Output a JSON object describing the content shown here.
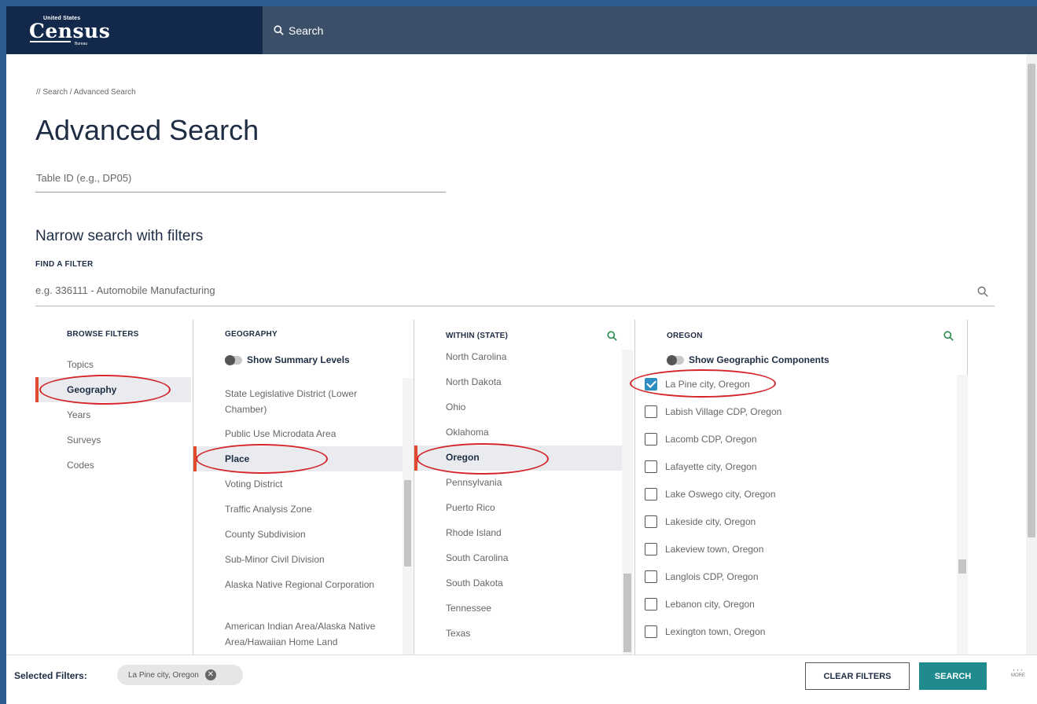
{
  "header": {
    "logo_top": "United States",
    "logo_main": "Census",
    "logo_bottom": "Bureau",
    "search_label": "Search"
  },
  "breadcrumb": "// Search / Advanced Search",
  "title": "Advanced Search",
  "table_id_placeholder": "Table ID (e.g., DP05)",
  "narrow_heading": "Narrow search with filters",
  "find_filter": {
    "label": "FIND A FILTER",
    "placeholder": "e.g. 336111 - Automobile Manufacturing"
  },
  "browse": {
    "heading": "BROWSE FILTERS",
    "items": [
      "Topics",
      "Geography",
      "Years",
      "Surveys",
      "Codes"
    ],
    "selected": "Geography"
  },
  "geography": {
    "heading": "GEOGRAPHY",
    "toggle_label": "Show Summary Levels",
    "items": [
      "State Legislative District (Lower Chamber)",
      "Public Use Microdata Area",
      "Place",
      "Voting District",
      "Traffic Analysis Zone",
      "County Subdivision",
      "Sub-Minor Civil Division",
      "Alaska Native Regional Corporation",
      "American Indian Area/Alaska Native Area/Hawaiian Home Land"
    ],
    "selected": "Place"
  },
  "within_state": {
    "heading": "WITHIN (STATE)",
    "items": [
      "North Carolina",
      "North Dakota",
      "Ohio",
      "Oklahoma",
      "Oregon",
      "Pennsylvania",
      "Puerto Rico",
      "Rhode Island",
      "South Carolina",
      "South Dakota",
      "Tennessee",
      "Texas"
    ],
    "selected": "Oregon"
  },
  "oregon": {
    "heading": "OREGON",
    "toggle_label": "Show Geographic Components",
    "places": [
      {
        "label": "La Pine city, Oregon",
        "checked": true
      },
      {
        "label": "Labish Village CDP, Oregon",
        "checked": false
      },
      {
        "label": "Lacomb CDP, Oregon",
        "checked": false
      },
      {
        "label": "Lafayette city, Oregon",
        "checked": false
      },
      {
        "label": "Lake Oswego city, Oregon",
        "checked": false
      },
      {
        "label": "Lakeside city, Oregon",
        "checked": false
      },
      {
        "label": "Lakeview town, Oregon",
        "checked": false
      },
      {
        "label": "Langlois CDP, Oregon",
        "checked": false
      },
      {
        "label": "Lebanon city, Oregon",
        "checked": false
      },
      {
        "label": "Lexington town, Oregon",
        "checked": false
      }
    ]
  },
  "footer": {
    "selected_label": "Selected Filters:",
    "chip": "La Pine city, Oregon",
    "chip_close": "✕",
    "clear_label": "CLEAR FILTERS",
    "search_label": "SEARCH",
    "more_label": "MORE"
  },
  "colors": {
    "header_bg": "#3b4f69",
    "logo_bg": "#13294b",
    "accent_red": "#e04a2f",
    "checkbox_blue": "#2e8ec3",
    "search_button": "#1f8b8f",
    "annotation_ellipse": "#d4252a"
  }
}
